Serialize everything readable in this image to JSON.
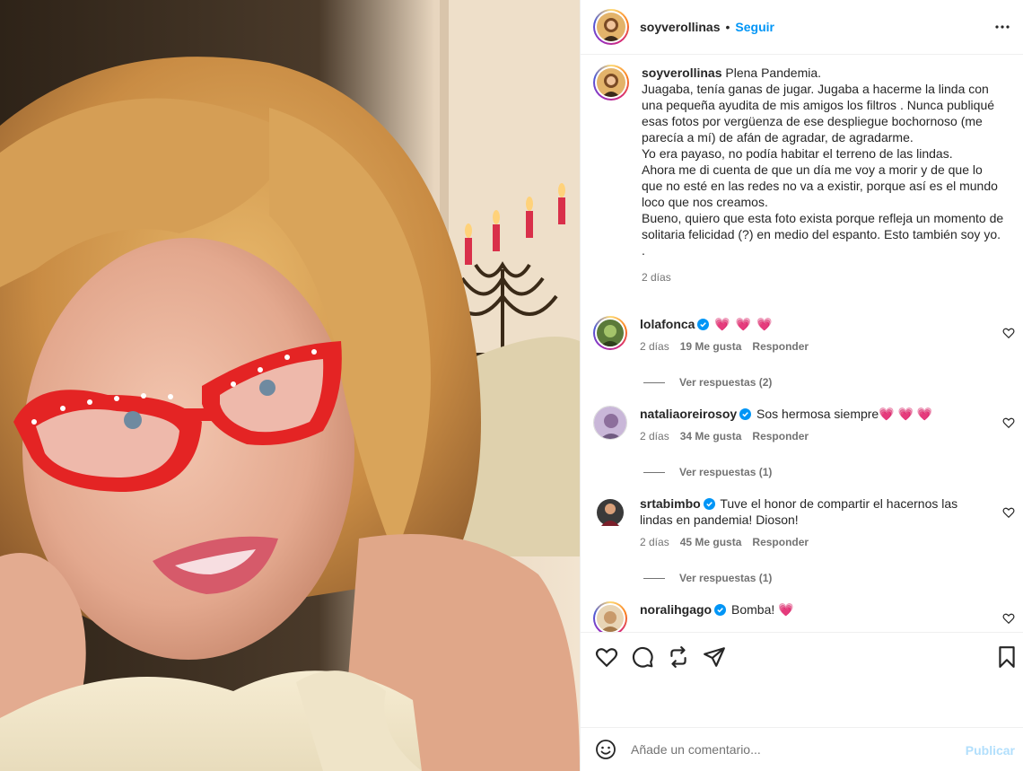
{
  "post": {
    "username": "soyverollinas",
    "separator": "•",
    "follow_label": "Seguir",
    "more_icon": "more-horizontal-icon"
  },
  "caption": {
    "username": "soyverollinas",
    "lines": [
      "Plena Pandemia.",
      "Juagaba, tenía ganas de jugar. Jugaba a hacerme la linda con una pequeña ayudita de mis amigos los filtros . Nunca publiqué esas fotos por vergüenza de ese despliegue bochornoso (me parecía a mí) de afán de agradar, de agradarme.",
      "Yo era payaso, no podía habitar el terreno de las lindas.",
      "Ahora me di cuenta de que un día me voy a morir y de que lo que no esté en las redes no va a existir, porque así es el mundo loco que nos creamos.",
      "Bueno, quiero que esta foto exista porque refleja un momento de solitaria felicidad (?) en medio del espanto. Esto también soy yo.",
      "."
    ],
    "time": "2 días"
  },
  "comments": [
    {
      "username": "lolafonca",
      "text": "💗 💗 💗",
      "time": "2 días",
      "likes": "19 Me gusta",
      "reply": "Responder",
      "view_replies": "Ver respuestas (2)"
    },
    {
      "username": "nataliaoreirosoy",
      "text": "Sos hermosa siempre💗 💗 💗",
      "time": "2 días",
      "likes": "34 Me gusta",
      "reply": "Responder",
      "view_replies": "Ver respuestas (1)"
    },
    {
      "username": "srtabimbo",
      "text": "Tuve el honor de compartir el hacernos las lindas en pandemia! Dioson!",
      "time": "2 días",
      "likes": "45 Me gusta",
      "reply": "Responder",
      "view_replies": "Ver respuestas (1)"
    },
    {
      "username": "noralihgago",
      "text": "Bomba! 💗"
    }
  ],
  "add_comment": {
    "placeholder": "Añade un comentario...",
    "publish_label": "Publicar"
  },
  "colors": {
    "link_blue": "#0095f6",
    "publish_disabled": "#b2dffc",
    "meta_gray": "#737373",
    "heart_pink": "#e8416a"
  }
}
